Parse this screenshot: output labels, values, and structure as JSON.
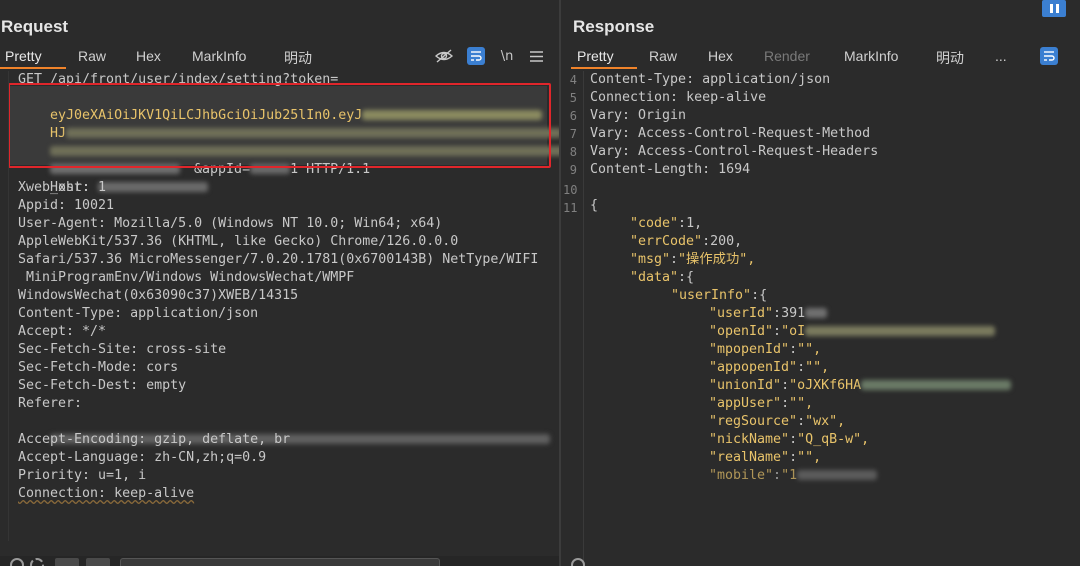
{
  "request": {
    "title": "Request",
    "tabs": [
      "Pretty",
      "Raw",
      "Hex",
      "MarkInfo",
      "明动"
    ],
    "active_tab": "Pretty",
    "tools": {
      "wrap_label": "\\n",
      "menu_icon": "hamburger-icon",
      "hide_icon": "eye-off-icon",
      "wrap_icon": "wrap-icon"
    },
    "lines": [
      "GET /api/front/user/index/setting?token=",
      "eyJ0eXAiOiJKV1QiLCJhbGciOiJub25lIn0.eyJ",
      "HJ",
      "",
      "",
      "Host: ",
      "Xweb_xhr: 1",
      "Appid: 10021",
      "User-Agent: Mozilla/5.0 (Windows NT 10.0; Win64; x64)",
      "AppleWebKit/537.36 (KHTML, like Gecko) Chrome/126.0.0.0",
      "Safari/537.36 MicroMessenger/7.0.20.1781(0x6700143B) NetType/WIFI",
      " MiniProgramEnv/Windows WindowsWechat/WMPF",
      "WindowsWechat(0x63090c37)XWEB/14315",
      "Content-Type: application/json",
      "Accept: */*",
      "Sec-Fetch-Site: cross-site",
      "Sec-Fetch-Mode: cors",
      "Sec-Fetch-Dest: empty",
      "Referer: ",
      "",
      "Accept-Encoding: gzip, deflate, br",
      "Accept-Language: zh-CN,zh;q=0.9",
      "Priority: u=1, i",
      "Connection: keep-alive"
    ],
    "token_tail": "&appId=",
    "token_proto": "1 HTTP/1.1",
    "token_line3_suffix": "S",
    "token_line4_suffix": "F"
  },
  "response": {
    "title": "Response",
    "tabs": [
      "Pretty",
      "Raw",
      "Hex",
      "Render",
      "MarkInfo",
      "明动",
      "..."
    ],
    "active_tab": "Pretty",
    "header_lines": [
      {
        "n": "4",
        "text": "Content-Type: application/json"
      },
      {
        "n": "5",
        "text": "Connection: keep-alive"
      },
      {
        "n": "6",
        "text": "Vary: Origin"
      },
      {
        "n": "7",
        "text": "Vary: Access-Control-Request-Method"
      },
      {
        "n": "8",
        "text": "Vary: Access-Control-Request-Headers"
      },
      {
        "n": "9",
        "text": "Content-Length: 1694"
      },
      {
        "n": "10",
        "text": ""
      },
      {
        "n": "11",
        "text": "{"
      }
    ],
    "json": {
      "code_key": "\"code\"",
      "code_val": "1,",
      "errcode_key": "\"errCode\"",
      "errcode_val": "200,",
      "msg_key": "\"msg\"",
      "msg_val": "\"操作成功\",",
      "data_key": "\"data\"",
      "data_val": ":{",
      "userinfo_key": "\"userInfo\"",
      "userinfo_val": ":{",
      "userid_key": "\"userId\"",
      "userid_val": "391",
      "openid_key": "\"openId\"",
      "openid_val": "\"oI",
      "mpopenid_key": "\"mpopenId\"",
      "mpopenid_val": "\"\",",
      "appopenid_key": "\"appopenId\"",
      "appopenid_val": "\"\",",
      "unionid_key": "\"unionId\"",
      "unionid_val": "\"oJXKf6HA",
      "appuser_key": "\"appUser\"",
      "appuser_val": "\"\",",
      "regsource_key": "\"regSource\"",
      "regsource_val": "\"wx\",",
      "nickname_key": "\"nickName\"",
      "nickname_val": "\"Q_qB-w\",",
      "realname_key": "\"realName\"",
      "realname_val": "\"\",",
      "mobile_key": "\"mobile\"",
      "mobile_val": "\"1"
    }
  },
  "colors": {
    "accent": "#f0832a",
    "blue_button": "#3b7fd1",
    "highlight_border": "#e0262b",
    "json_key": "#e8c36a"
  }
}
